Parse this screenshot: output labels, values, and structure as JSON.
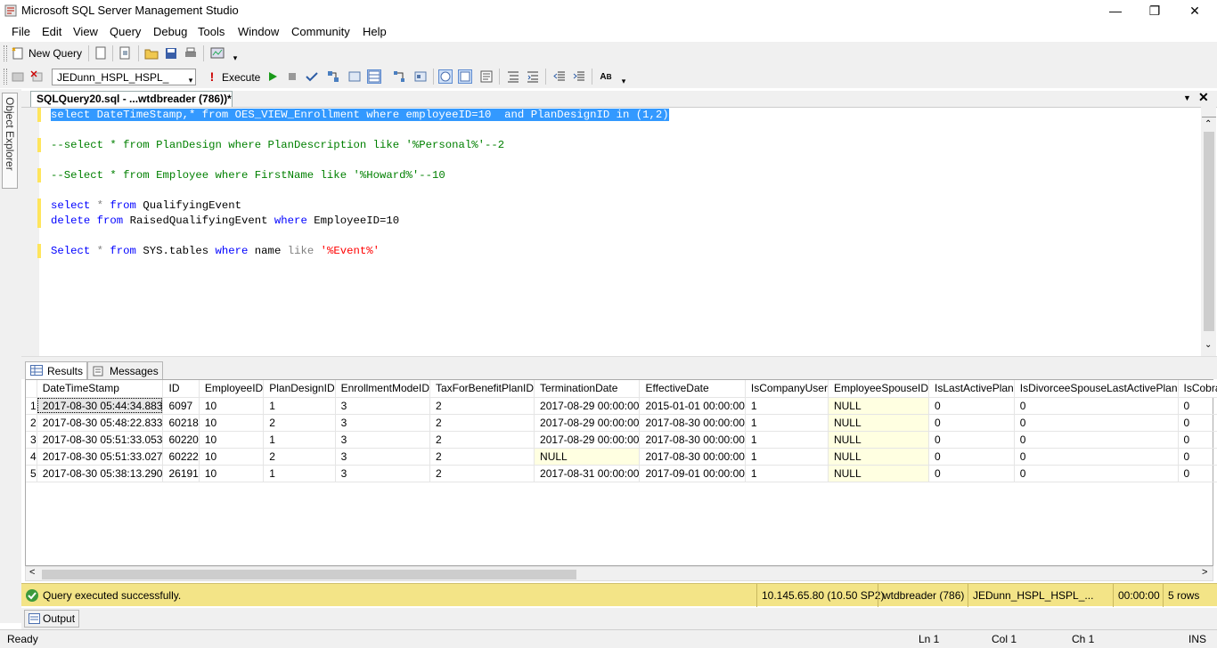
{
  "window": {
    "title": "Microsoft SQL Server Management Studio"
  },
  "menu": [
    "File",
    "Edit",
    "View",
    "Query",
    "Debug",
    "Tools",
    "Window",
    "Community",
    "Help"
  ],
  "toolbar1": {
    "new_query": "New Query"
  },
  "toolbar2": {
    "database": "JEDunn_HSPL_HSPL_",
    "execute": "Execute"
  },
  "sidebar": {
    "object_explorer": "Object Explorer"
  },
  "doc_tab": {
    "label": "SQLQuery20.sql - ...wtdbreader (786))*"
  },
  "editor": {
    "line1": "select DateTimeStamp,* from OES_VIEW_Enrollment where employeeID=10  and PlanDesignID in (1,2)",
    "line3": "--select * from PlanDesign where PlanDescription like '%Personal%'--2",
    "line5": "--Select * from Employee where FirstName like '%Howard%'--10",
    "line7_kw1": "select",
    "line7_op": " * ",
    "line7_kw2": "from",
    "line7_rest": " QualifyingEvent",
    "line8_kw1": "delete",
    "line8_kw2": " from",
    "line8_mid": " RaisedQualifyingEvent ",
    "line8_kw3": "where",
    "line8_rest": " EmployeeID=10",
    "line10_kw1": "Select",
    "line10_op": " * ",
    "line10_kw2": "from",
    "line10_mid": " SYS.tables ",
    "line10_kw3": "where",
    "line10_name": " name ",
    "line10_like": "like",
    "line10_str": " '%Event%'"
  },
  "results_tabs": {
    "results": "Results",
    "messages": "Messages"
  },
  "grid": {
    "columns": [
      "DateTimeStamp",
      "ID",
      "EmployeeID",
      "PlanDesignID",
      "EnrollmentModeID",
      "TaxForBenefitPlanID",
      "TerminationDate",
      "EffectiveDate",
      "IsCompanyUser",
      "EmployeeSpouseID",
      "IsLastActivePlan",
      "IsDivorceeSpouseLastActivePlan",
      "IsCobra"
    ],
    "rows": [
      [
        "1",
        "2017-08-30 05:44:34.883",
        "6097",
        "10",
        "1",
        "3",
        "2",
        "2017-08-29 00:00:00",
        "2015-01-01 00:00:00",
        "1",
        "NULL",
        "0",
        "0",
        "0"
      ],
      [
        "2",
        "2017-08-30 05:48:22.833",
        "60218",
        "10",
        "2",
        "3",
        "2",
        "2017-08-29 00:00:00",
        "2017-08-30 00:00:00",
        "1",
        "NULL",
        "0",
        "0",
        "0"
      ],
      [
        "3",
        "2017-08-30 05:51:33.053",
        "60220",
        "10",
        "1",
        "3",
        "2",
        "2017-08-29 00:00:00",
        "2017-08-30 00:00:00",
        "1",
        "NULL",
        "0",
        "0",
        "0"
      ],
      [
        "4",
        "2017-08-30 05:51:33.027",
        "60222",
        "10",
        "2",
        "3",
        "2",
        "NULL",
        "2017-08-30 00:00:00",
        "1",
        "NULL",
        "0",
        "0",
        "0"
      ],
      [
        "5",
        "2017-08-30 05:38:13.290",
        "26191",
        "10",
        "1",
        "3",
        "2",
        "2017-08-31 00:00:00",
        "2017-09-01 00:00:00",
        "1",
        "NULL",
        "0",
        "0",
        "0"
      ]
    ]
  },
  "query_status": {
    "message": "Query executed successfully.",
    "server": "10.145.65.80 (10.50 SP2)",
    "user": "wtdbreader (786)",
    "database": "JEDunn_HSPL_HSPL_...",
    "elapsed": "00:00:00",
    "rows": "5 rows"
  },
  "output_tab": "Output",
  "app_status": {
    "ready": "Ready",
    "ln": "Ln 1",
    "col": "Col 1",
    "ch": "Ch 1",
    "ins": "INS"
  }
}
